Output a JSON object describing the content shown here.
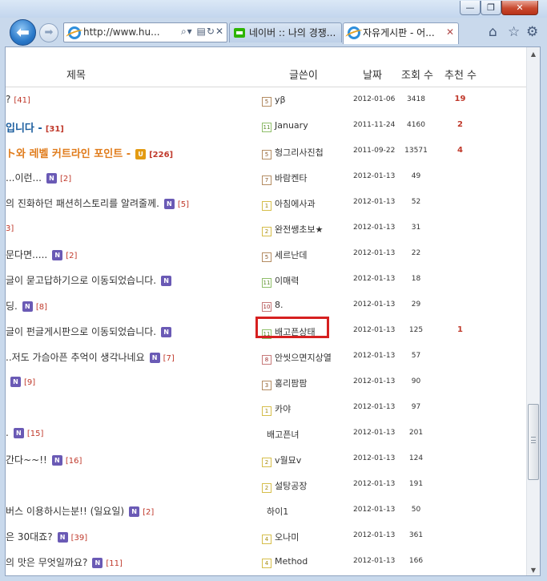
{
  "browser": {
    "address": "http://www.hu...",
    "tabs": [
      {
        "label": "네이버 :: 나의 경쟁...",
        "active": false
      },
      {
        "label": "자유게시판 - 어...",
        "active": true
      }
    ]
  },
  "board": {
    "headers": {
      "title": "제목",
      "author": "글쓴이",
      "date": "날짜",
      "views": "조회 수",
      "recs": "추천 수"
    },
    "rows": [
      {
        "title": "?",
        "count": "[41]",
        "style": "normal",
        "badge": "",
        "level": "5",
        "levelColor": "brown",
        "author": "yβ",
        "date": "2012-01-06",
        "views": "3418",
        "recs": "19"
      },
      {
        "title": "입니다 -",
        "count": "[31]",
        "style": "blue",
        "badge": "",
        "level": "11",
        "levelColor": "green",
        "author": "January",
        "date": "2011-11-24",
        "views": "4160",
        "recs": "2"
      },
      {
        "title": "ト와 레벨 커트라인 포인트 -",
        "count": "[226]",
        "style": "hot",
        "badge": "U",
        "level": "5",
        "levelColor": "brown",
        "author": "헝그리사진첩",
        "date": "2011-09-22",
        "views": "13571",
        "recs": "4"
      },
      {
        "title": "...이런...",
        "count": "[2]",
        "style": "normal",
        "badge": "N",
        "level": "7",
        "levelColor": "brown",
        "author": "바람켄타",
        "date": "2012-01-13",
        "views": "49",
        "recs": ""
      },
      {
        "title": "의 진화하던 패션히스토리를 알려줄께.",
        "count": "[5]",
        "style": "normal",
        "badge": "N",
        "level": "1",
        "levelColor": "yellow",
        "author": "아침에사과",
        "date": "2012-01-13",
        "views": "52",
        "recs": ""
      },
      {
        "title": "3]",
        "count": "",
        "style": "count",
        "badge": "",
        "level": "2",
        "levelColor": "yellow",
        "author": "완전쌩초보★",
        "date": "2012-01-13",
        "views": "31",
        "recs": ""
      },
      {
        "title": "문다면.....",
        "count": "[2]",
        "style": "normal",
        "badge": "N",
        "level": "5",
        "levelColor": "brown",
        "author": "세르난데",
        "date": "2012-01-13",
        "views": "22",
        "recs": ""
      },
      {
        "title": "글이 묻고답하기으로 이동되었습니다.",
        "count": "",
        "style": "normal",
        "badge": "N",
        "level": "11",
        "levelColor": "green",
        "author": "이매력",
        "date": "2012-01-13",
        "views": "18",
        "recs": ""
      },
      {
        "title": "딩.",
        "count": "[8]",
        "style": "normal",
        "badge": "N",
        "level": "10",
        "levelColor": "red",
        "author": "8.",
        "date": "2012-01-13",
        "views": "29",
        "recs": ""
      },
      {
        "title": "글이 펀글게시판으로 이동되었습니다.",
        "count": "",
        "style": "normal",
        "badge": "N",
        "level": "11",
        "levelColor": "green",
        "author": "배고픈상태",
        "date": "2012-01-13",
        "views": "125",
        "recs": "1"
      },
      {
        "title": "..저도 가슴아픈 추억이 생각나네요",
        "count": "[7]",
        "style": "normal",
        "badge": "N",
        "level": "8",
        "levelColor": "red",
        "author": "안씻으면지상열",
        "date": "2012-01-13",
        "views": "57",
        "recs": ""
      },
      {
        "title": "",
        "count": "[9]",
        "style": "normal",
        "badge": "N",
        "level": "3",
        "levelColor": "brown",
        "author": "홍리팜팜",
        "date": "2012-01-13",
        "views": "90",
        "recs": ""
      },
      {
        "title": "",
        "count": "",
        "style": "normal",
        "badge": "",
        "level": "1",
        "levelColor": "yellow",
        "author": "카야",
        "date": "2012-01-13",
        "views": "97",
        "recs": ""
      },
      {
        "title": ".",
        "count": "[15]",
        "style": "normal",
        "badge": "N",
        "level": "",
        "levelColor": "",
        "author": "배고픈녀",
        "date": "2012-01-13",
        "views": "201",
        "recs": ""
      },
      {
        "title": "간다~~!!",
        "count": "[16]",
        "style": "normal",
        "badge": "N",
        "level": "2",
        "levelColor": "yellow",
        "author": "v월묘v",
        "date": "2012-01-13",
        "views": "124",
        "recs": ""
      },
      {
        "title": "",
        "count": "",
        "style": "normal",
        "badge": "",
        "level": "2",
        "levelColor": "yellow",
        "author": "설탕공장",
        "date": "2012-01-13",
        "views": "191",
        "recs": ""
      },
      {
        "title": "버스 이용하시는분!! (일요일)",
        "count": "[2]",
        "style": "normal",
        "badge": "N",
        "level": "",
        "levelColor": "",
        "author": "하이1",
        "date": "2012-01-13",
        "views": "50",
        "recs": ""
      },
      {
        "title": "은 30대죠?",
        "count": "[39]",
        "style": "normal",
        "badge": "N",
        "level": "4",
        "levelColor": "yellow",
        "author": "오나미",
        "date": "2012-01-13",
        "views": "361",
        "recs": ""
      },
      {
        "title": "의 맛은 무엇일까요?",
        "count": "[11]",
        "style": "normal",
        "badge": "N",
        "level": "4",
        "levelColor": "yellow",
        "author": "Method",
        "date": "2012-01-13",
        "views": "166",
        "recs": ""
      }
    ]
  }
}
